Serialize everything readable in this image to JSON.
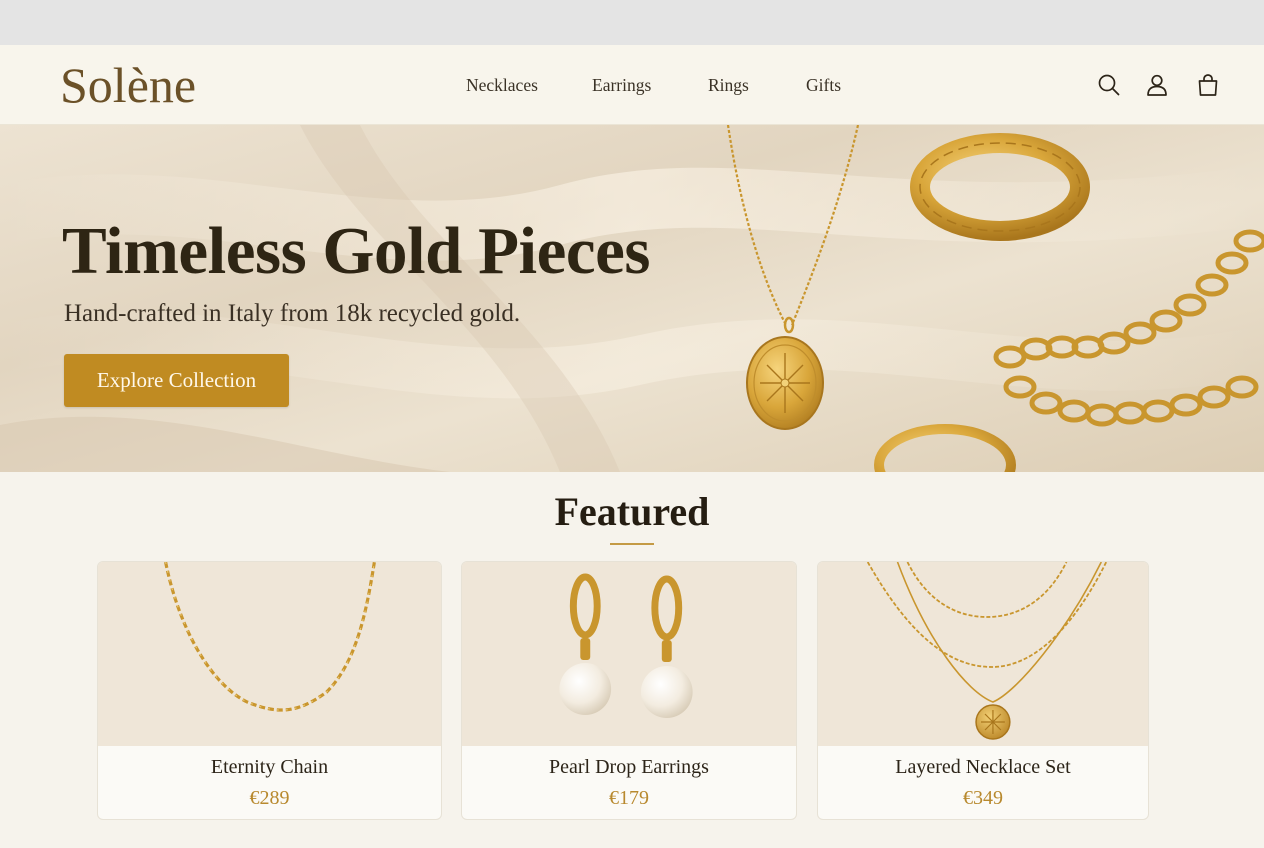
{
  "header": {
    "logo": "Solène",
    "nav": [
      {
        "label": "Necklaces"
      },
      {
        "label": "Earrings"
      },
      {
        "label": "Rings"
      },
      {
        "label": "Gifts"
      }
    ],
    "icons": [
      "search-icon",
      "user-icon",
      "shopping-bag-icon"
    ]
  },
  "hero": {
    "title": "Timeless Gold Pieces",
    "subtitle": "Hand-crafted in Italy from 18k recycled gold.",
    "cta_label": "Explore Collection"
  },
  "featured": {
    "title": "Featured",
    "products": [
      {
        "name": "Eternity Chain",
        "price": "€289"
      },
      {
        "name": "Pearl Drop Earrings",
        "price": "€179"
      },
      {
        "name": "Layered Necklace Set",
        "price": "€349"
      }
    ]
  },
  "colors": {
    "accent": "#c08b22",
    "logo": "#6b5128",
    "price": "#b8892e",
    "background": "#f6f3ec"
  }
}
